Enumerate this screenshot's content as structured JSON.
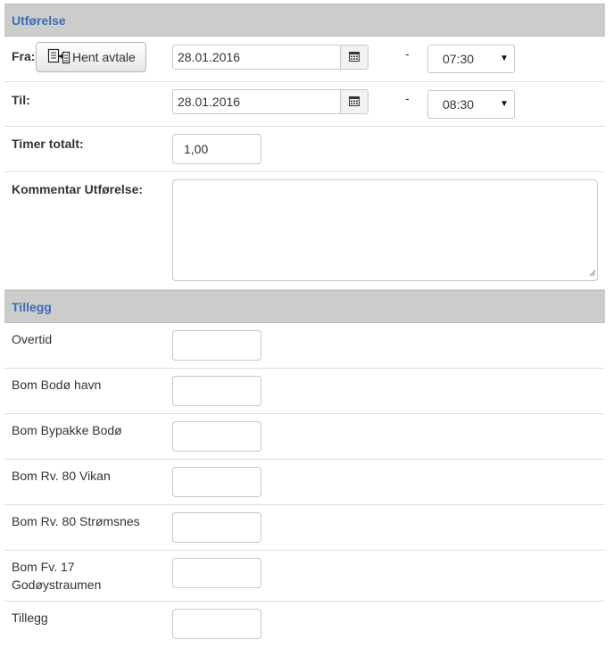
{
  "utforelse": {
    "header": "Utførelse",
    "fra": {
      "label": "Fra:",
      "hent_button_label": "Hent avtale",
      "date": "28.01.2016",
      "dash": "-",
      "time": "07:30"
    },
    "til": {
      "label": "Til:",
      "date": "28.01.2016",
      "dash": "-",
      "time": "08:30"
    },
    "timer_totalt": {
      "label": "Timer totalt:",
      "value": "1,00"
    },
    "kommentar": {
      "label": "Kommentar Utførelse:",
      "value": ""
    }
  },
  "tillegg": {
    "header": "Tillegg",
    "items": [
      {
        "label": "Overtid",
        "value": ""
      },
      {
        "label": "Bom Bodø havn",
        "value": ""
      },
      {
        "label": "Bom Bypakke Bodø",
        "value": ""
      },
      {
        "label": "Bom Rv. 80 Vikan",
        "value": ""
      },
      {
        "label": "Bom Rv. 80 Strømsnes",
        "value": ""
      },
      {
        "label": "Bom Fv. 17 Godøystraumen",
        "value": ""
      },
      {
        "label": "Tillegg",
        "value": ""
      }
    ]
  },
  "icons": {
    "hent": "document-copy-icon",
    "calendar": "calendar-icon",
    "caret": "caret-down-icon"
  },
  "colors": {
    "header_bg": "#cccccc",
    "header_text": "#3a6eb5"
  }
}
